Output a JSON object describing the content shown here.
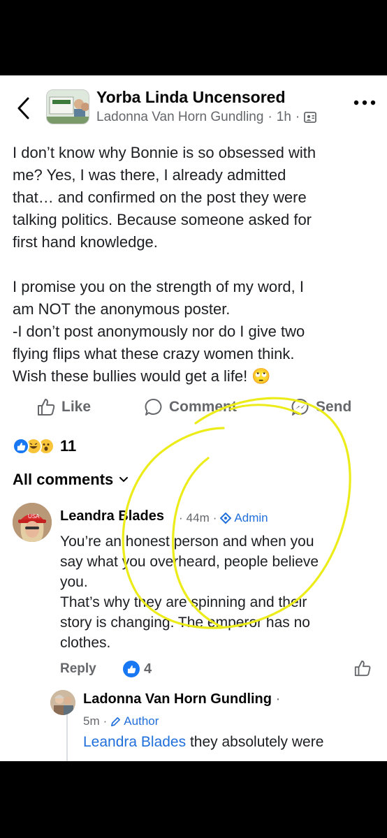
{
  "header": {
    "group_name": "Yorba Linda Uncensored",
    "author": "Ladonna Van Horn Gundling",
    "time": "1h",
    "separator": "·",
    "back_icon": "chevron-left-icon",
    "more_icon": "more-horizontal-icon",
    "privacy_icon": "members-icon"
  },
  "post": {
    "paragraph_1": "I don’t know why Bonnie is so obsessed with\nme? Yes, I was there, I already admitted\nthat… and confirmed on the post they were\ntalking politics. Because someone asked for\nfirst hand knowledge.",
    "paragraph_2": "I promise you on the strength of my word, I\nam NOT the anonymous poster.\n-I don’t post anonymously nor do I give two\nflying flips what these crazy women think.\nWish these bullies would get a life! 🙄"
  },
  "actions": {
    "like": "Like",
    "comment": "Comment",
    "send": "Send"
  },
  "reactions": {
    "types": [
      "like",
      "haha",
      "wow"
    ],
    "count": "11"
  },
  "comments_filter": {
    "label": "All comments"
  },
  "comment": {
    "author": "Leandra Blades",
    "time": "44m",
    "badge": "Admin",
    "text": "You’re an honest person and when you\nsay what you overheard, people believe\nyou.\nThat’s why they are spinning and their\nstory is changing. The emperor has no\nclothes.",
    "reply_label": "Reply",
    "like_count": "4"
  },
  "reply": {
    "author": "Ladonna Van Horn Gundling",
    "time": "5m",
    "badge": "Author",
    "mention": "Leandra Blades",
    "text": " they absolutely were"
  },
  "colors": {
    "accent_blue": "#216fdb",
    "like_blue": "#1877f2",
    "secondary_text": "#65676b",
    "annotation_yellow": "#ecec1a"
  }
}
